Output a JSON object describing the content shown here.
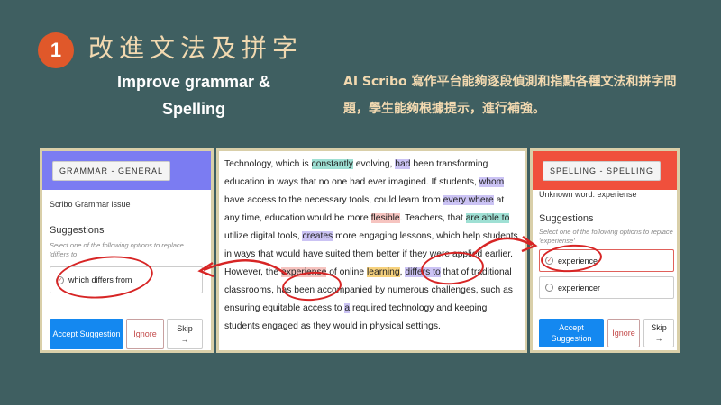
{
  "slide": {
    "step_number": "1",
    "heading_zh": "改進文法及拼字",
    "heading_en": "Improve grammar & Spelling",
    "description_zh": "AI Scribo 寫作平台能夠逐段偵測和指點各種文法和拼字問題，學生能夠根據提示，進行補強。"
  },
  "grammar_panel": {
    "tag": "GRAMMAR - GENERAL",
    "issue": "Scribo Grammar issue",
    "suggestions_title": "Suggestions",
    "hint": "Select one of the following options to replace 'differs to'",
    "option": "which differs from",
    "accept_label": "Accept Suggestion",
    "ignore_label": "Ignore",
    "skip_label": "Skip",
    "skip_arrow": "→",
    "header_color": "#7b7cf2"
  },
  "document": {
    "segments": [
      {
        "t": "Technology, which is "
      },
      {
        "t": "constantly",
        "h": "t"
      },
      {
        "t": " evolving, "
      },
      {
        "t": "had",
        "h": "p"
      },
      {
        "t": " been transforming education in ways that no one had ever imagined. If students, "
      },
      {
        "t": "whom",
        "h": "p"
      },
      {
        "t": " have access to the necessary tools, could learn from "
      },
      {
        "t": "every where",
        "h": "p"
      },
      {
        "t": " at any time, education would be more "
      },
      {
        "t": "flesible",
        "h": "r"
      },
      {
        "t": ". Teachers, that "
      },
      {
        "t": "are able to",
        "h": "t"
      },
      {
        "t": " utilize digital tools, "
      },
      {
        "t": "creates",
        "h": "p"
      },
      {
        "t": " more engaging lessons, which help students in ways that would have suited them better if they were applied earlier. However, the "
      },
      {
        "t": "experiense",
        "h": "r"
      },
      {
        "t": " of online "
      },
      {
        "t": "learning",
        "h": "o"
      },
      {
        "t": ", "
      },
      {
        "t": "differs to",
        "h": "p"
      },
      {
        "t": " that of traditional classrooms, has been accompanied by numerous challenges, such as ensuring equitable access to "
      },
      {
        "t": "a",
        "h": "p"
      },
      {
        "t": " required technology and keeping students engaged as they would in physical settings."
      }
    ]
  },
  "spelling_panel": {
    "tag": "SPELLING - SPELLING",
    "issue": "Unknown word: experiense",
    "suggestions_title": "Suggestions",
    "hint": "Select one of the following options to replace 'experiense'",
    "options": [
      "experience",
      "experiencer"
    ],
    "accept_label": "Accept Suggestion",
    "ignore_label": "Ignore",
    "skip_label": "Skip",
    "skip_arrow": "→",
    "header_color": "#f0503c"
  },
  "colors": {
    "background": "#3f5f61",
    "badge": "#e0582a",
    "accent_text": "#f2d9b0",
    "annotation_red": "#d72525",
    "primary_button": "#1488f0"
  }
}
